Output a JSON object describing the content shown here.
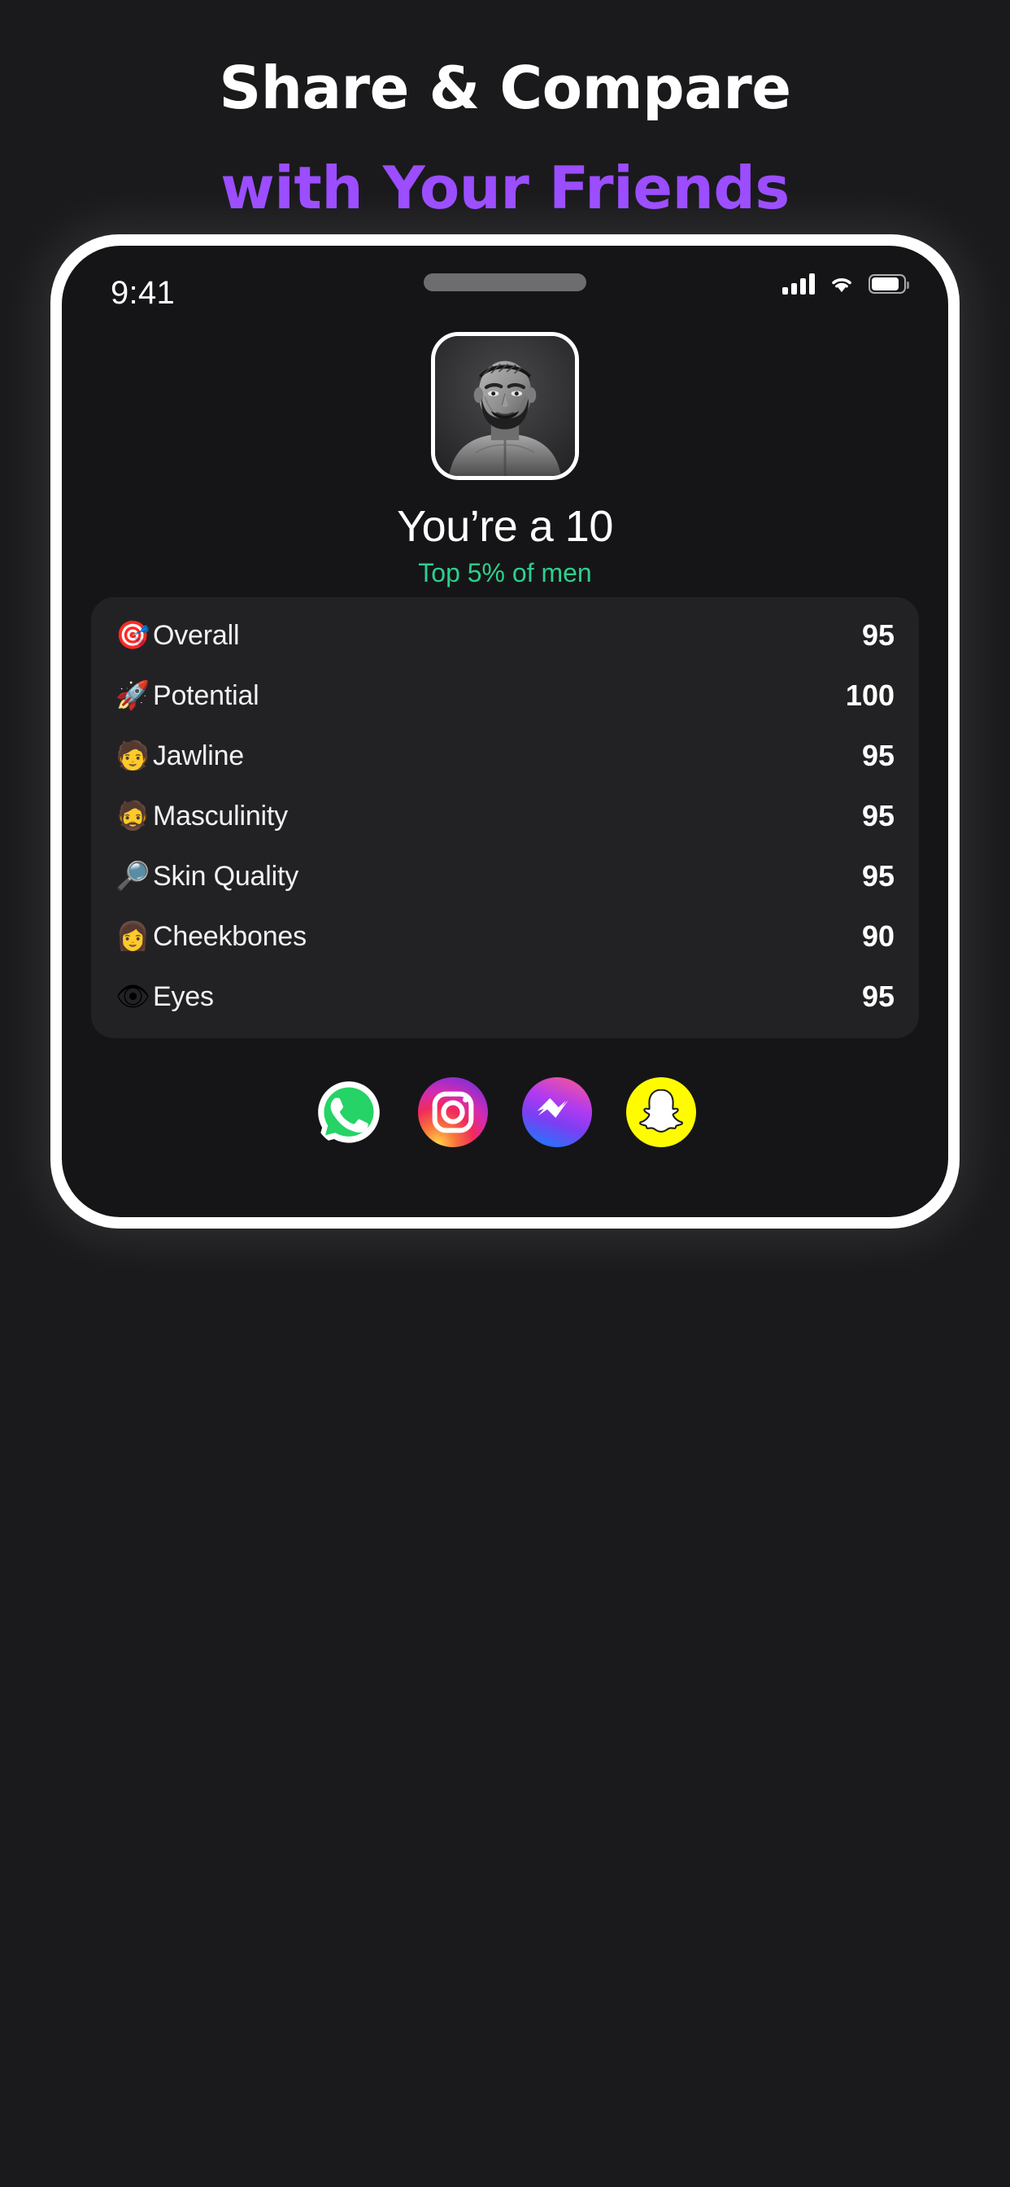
{
  "headline": {
    "line1": "Share & Compare",
    "line2": "with Your Friends",
    "accent_color": "#9b4dff"
  },
  "phone": {
    "statusbar": {
      "time": "9:41",
      "signal_icon": "cellular-signal-icon",
      "wifi_icon": "wifi-icon",
      "battery_icon": "battery-icon"
    },
    "profile": {
      "avatar_alt": "user-photo",
      "score_title": "You’re a 10",
      "score_subtitle": "Top 5% of men",
      "subtitle_color": "#2ecf8d"
    },
    "stats": {
      "rows": [
        {
          "emoji": "🎯",
          "icon_name": "target-icon",
          "label": "Overall",
          "value": "95"
        },
        {
          "emoji": "🚀",
          "icon_name": "rocket-icon",
          "label": "Potential",
          "value": "100"
        },
        {
          "emoji": "🧑",
          "icon_name": "face-profile-icon",
          "label": "Jawline",
          "value": "95"
        },
        {
          "emoji": "🧔",
          "icon_name": "bearded-man-icon",
          "label": "Masculinity",
          "value": "95"
        },
        {
          "emoji": "🔎",
          "icon_name": "skin-magnifier-icon",
          "label": "Skin Quality",
          "value": "95"
        },
        {
          "emoji": "👩",
          "icon_name": "cheeks-face-icon",
          "label": "Cheekbones",
          "value": "90"
        },
        {
          "emoji": "👁",
          "icon_name": "eye-icon",
          "label": "Eyes",
          "value": "95"
        }
      ]
    },
    "share": {
      "buttons": [
        {
          "name": "whatsapp-share-button",
          "label": "WhatsApp"
        },
        {
          "name": "instagram-share-button",
          "label": "Instagram"
        },
        {
          "name": "messenger-share-button",
          "label": "Messenger"
        },
        {
          "name": "snapchat-share-button",
          "label": "Snapchat"
        }
      ]
    }
  }
}
